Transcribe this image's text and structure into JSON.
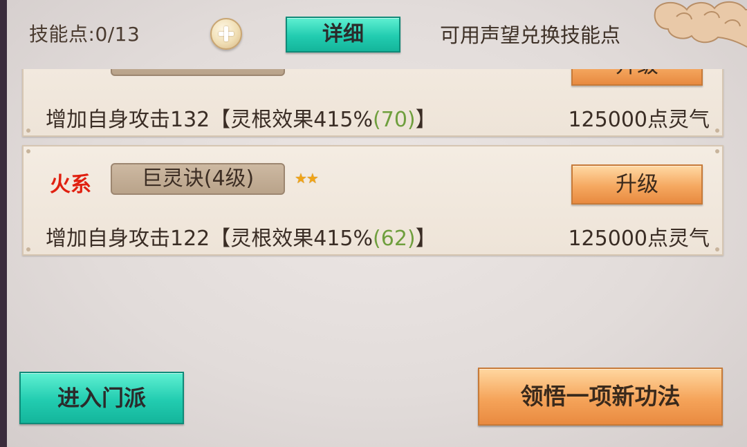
{
  "header": {
    "skill_points_label": "技能点:",
    "skill_points_value": "0/13",
    "detail_button": "详细",
    "reputation_link": "可用声望兑换技能点"
  },
  "skills": [
    {
      "element": "",
      "name": "",
      "stars": "",
      "upgrade_label": "升级",
      "effect_prefix": "增加自身攻击132【灵根效果415%",
      "effect_bonus": "(70)",
      "effect_suffix": "】",
      "cost": "125000点灵气"
    },
    {
      "element": "火系",
      "name": "巨灵诀(4级)",
      "stars": "★★",
      "upgrade_label": "升级",
      "effect_prefix": "增加自身攻击122【灵根效果415%",
      "effect_bonus": "(62)",
      "effect_suffix": "】",
      "cost": "125000点灵气"
    }
  ],
  "footer": {
    "enter_sect_button": "进入门派",
    "learn_new_skill_button": "领悟一项新功法"
  }
}
